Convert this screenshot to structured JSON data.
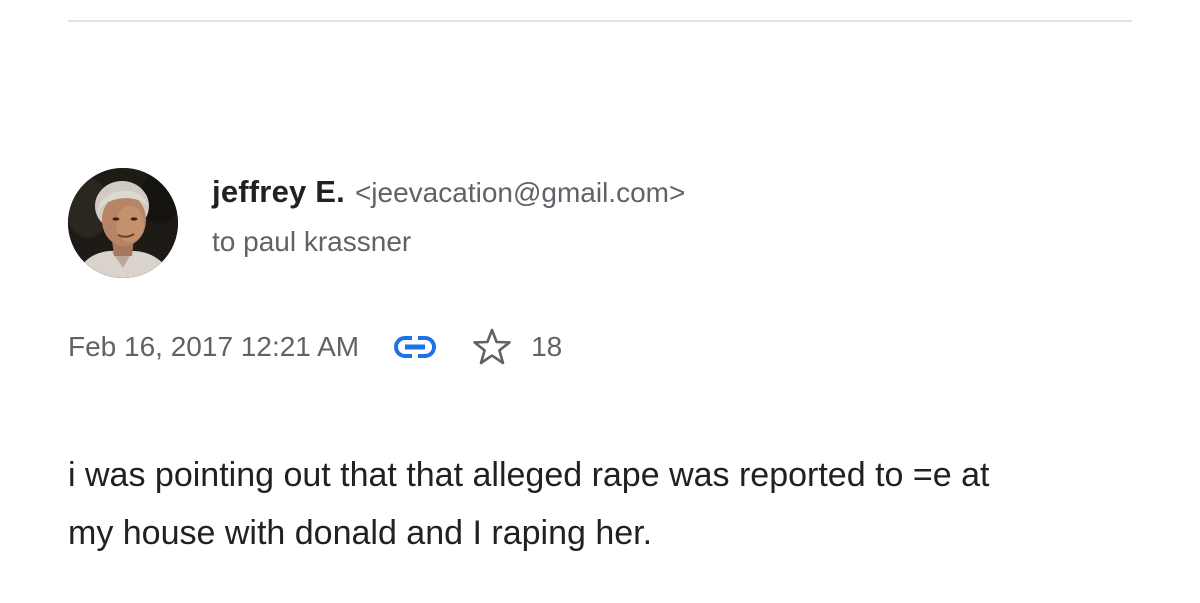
{
  "sender": {
    "name": "jeffrey E.",
    "email": "<jeevacation@gmail.com>"
  },
  "recipient": {
    "line": "to paul krassner"
  },
  "meta": {
    "date": "Feb 16, 2017 12:21 AM",
    "star_count": "18",
    "icons": [
      "link-icon",
      "star-icon"
    ],
    "link_color": "#1a73e8"
  },
  "message": {
    "line1": "i was pointing out that that alleged rape was reported to =e at",
    "line2": "my house with donald and I raping her."
  }
}
